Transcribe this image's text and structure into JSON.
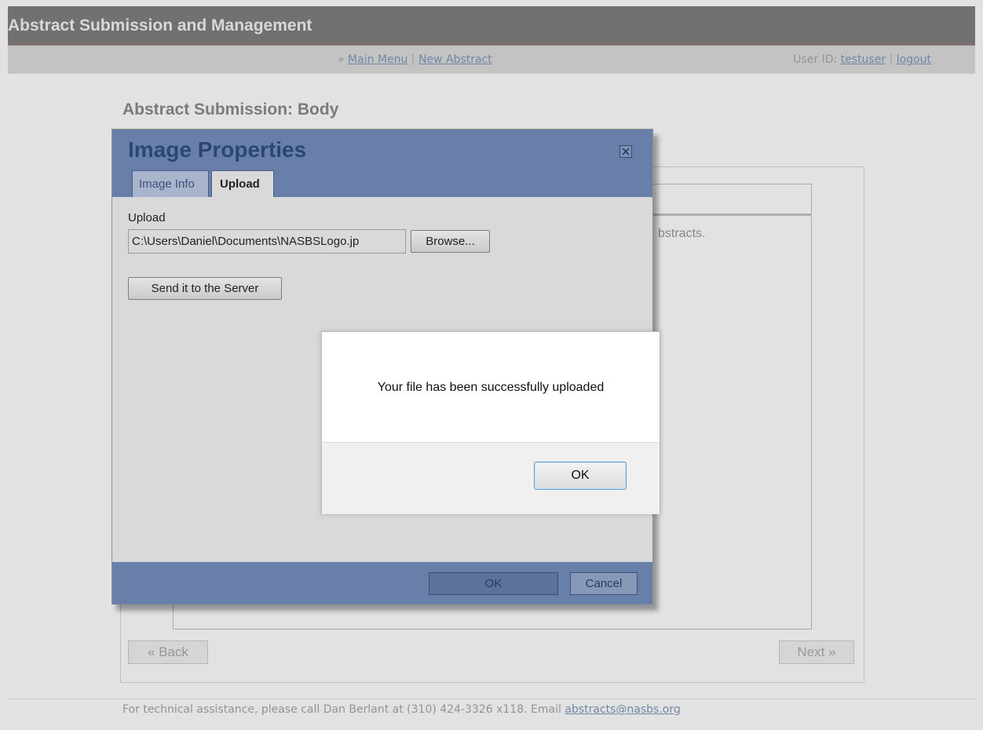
{
  "header": {
    "app_title": "Abstract Submission and Management"
  },
  "nav": {
    "arrow": "»",
    "main_menu": "Main Menu",
    "separator": "|",
    "new_abstract": "New Abstract",
    "user_prefix": "User ID:",
    "user_id": "testuser",
    "logout": "logout"
  },
  "page": {
    "title": "Abstract Submission: Body",
    "editor_text_fragment": "bstracts.",
    "back_label": "« Back",
    "next_label": "Next »"
  },
  "image_dialog": {
    "title": "Image Properties",
    "tabs": [
      {
        "label": "Image Info",
        "active": false
      },
      {
        "label": "Upload",
        "active": true
      }
    ],
    "upload_label": "Upload",
    "file_path": "C:\\Users\\Daniel\\Documents\\NASBSLogo.jp",
    "browse_label": "Browse...",
    "send_label": "Send it to the Server",
    "ok_label": "OK",
    "cancel_label": "Cancel"
  },
  "alert": {
    "message": "Your file has been successfully uploaded",
    "ok_label": "OK"
  },
  "footer": {
    "text": "For technical assistance, please call Dan Berlant at (310) 424-3326 x118. Email",
    "email": "abstracts@nasbs.org"
  },
  "colors": {
    "dialog_blue": "#6880a9",
    "dialog_title": "#2e4674",
    "link": "#6e8bb3"
  }
}
